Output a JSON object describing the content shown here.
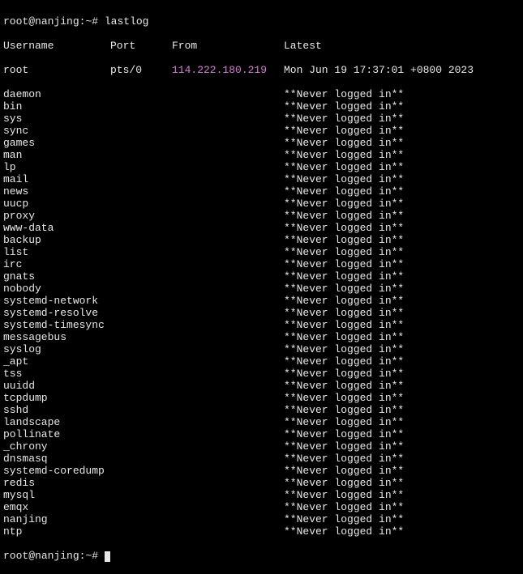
{
  "prompt": {
    "user": "root",
    "at": "@",
    "host": "nanjing",
    "path": ":~#",
    "command": "lastlog"
  },
  "header": {
    "username": "Username",
    "port": "Port",
    "from": "From",
    "latest": "Latest"
  },
  "never": "**Never logged in**",
  "root_entry": {
    "username": "root",
    "port": "pts/0",
    "from": "114.222.180.219",
    "latest": "Mon Jun 19 17:37:01 +0800 2023"
  },
  "users": [
    "daemon",
    "bin",
    "sys",
    "sync",
    "games",
    "man",
    "lp",
    "mail",
    "news",
    "uucp",
    "proxy",
    "www-data",
    "backup",
    "list",
    "irc",
    "gnats",
    "nobody",
    "systemd-network",
    "systemd-resolve",
    "systemd-timesync",
    "messagebus",
    "syslog",
    "_apt",
    "tss",
    "uuidd",
    "tcpdump",
    "sshd",
    "landscape",
    "pollinate",
    "_chrony",
    "dnsmasq",
    "systemd-coredump",
    "redis",
    "mysql",
    "emqx",
    "nanjing",
    "ntp"
  ]
}
